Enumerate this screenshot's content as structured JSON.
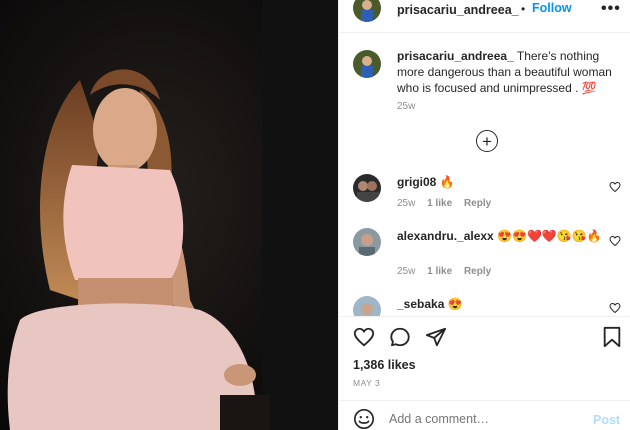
{
  "post": {
    "username": "prisacariu_andreea_",
    "dot": "•",
    "follow_label": "Follow",
    "more_label": "•••",
    "photo_alt": "Photo by prisacariu_andreea_"
  },
  "caption": {
    "username": "prisacariu_andreea_",
    "text": "There's nothing more dangerous than a beautiful woman who is focused and unimpressed . 💯",
    "time": "25w"
  },
  "load_more_label": "+",
  "comments": [
    {
      "username": "grigi08",
      "text": "🔥",
      "time": "25w",
      "likes": "",
      "reply": ""
    },
    {
      "username": "alexandru._alexx",
      "text": "😍😍❤️❤️😘😘🔥",
      "time": "25w",
      "likes": "1 like",
      "reply": "Reply"
    },
    {
      "username": "_sebaka",
      "text": "😍",
      "time": "",
      "likes": "",
      "reply": ""
    }
  ],
  "comment0_meta": {
    "time": "25w",
    "likes": "1 like",
    "reply": "Reply"
  },
  "stats": {
    "likes": "1,386 likes",
    "date": "MAY 3"
  },
  "add_comment": {
    "placeholder": "Add a comment…",
    "post_label": "Post"
  },
  "colors": {
    "accent": "#0095f6",
    "post_disabled": "#b3dbff",
    "muted": "#8e8e8e"
  }
}
